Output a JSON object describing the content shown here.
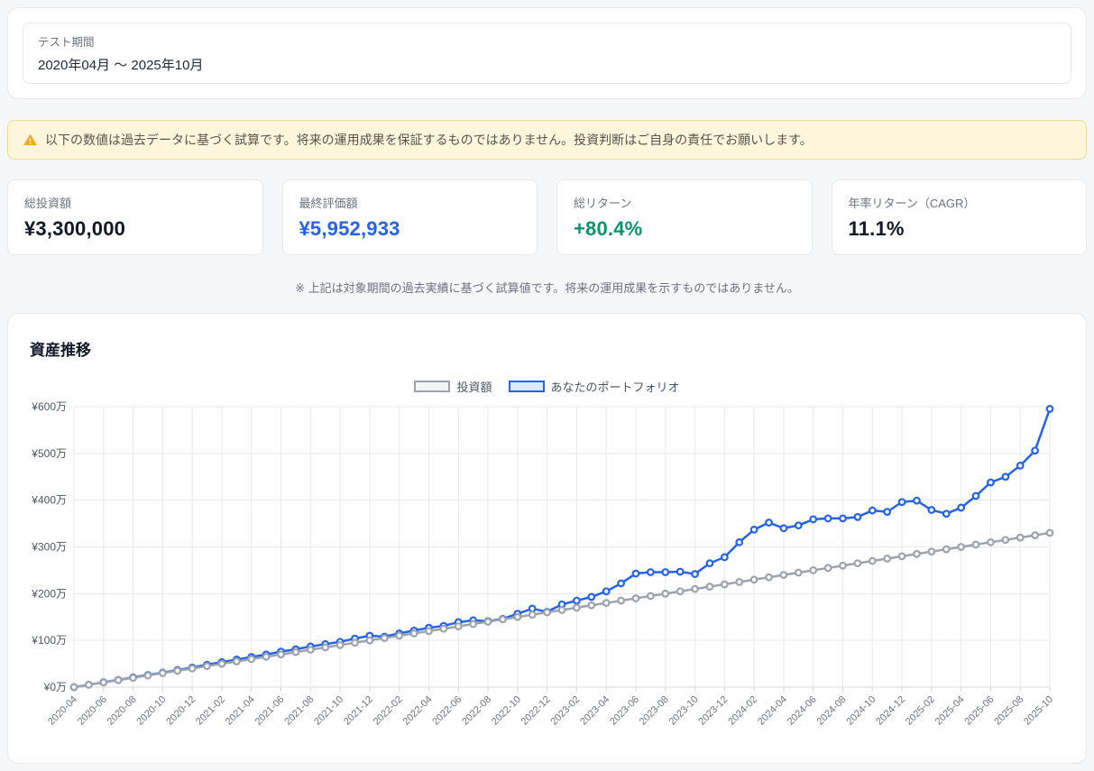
{
  "period": {
    "label": "テスト期間",
    "value": "2020年04月 〜 2025年10月"
  },
  "warning": {
    "text": "以下の数値は過去データに基づく試算です。将来の運用成果を保証するものではありません。投資判断はご自身の責任でお願いします。",
    "icon_color": "#f5a623"
  },
  "stats": [
    {
      "label": "総投資額",
      "value": "¥3,300,000",
      "color": "#111827"
    },
    {
      "label": "最終評価額",
      "value": "¥5,952,933",
      "color": "#2563eb"
    },
    {
      "label": "総リターン",
      "value": "+80.4%",
      "color": "#059669"
    },
    {
      "label": "年率リターン（CAGR）",
      "value": "11.1%",
      "color": "#111827"
    }
  ],
  "footnote": "※ 上記は対象期間の過去実績に基づく試算値です。将来の運用成果を示すものではありません。",
  "chart": {
    "title": "資産推移"
  },
  "chart_data": {
    "type": "line",
    "title": "資産推移",
    "unit": "万円 (10,000 JPY)",
    "y_prefix": "¥",
    "y_suffix": "万",
    "y_ticks": [
      0,
      100,
      200,
      300,
      400,
      500,
      600
    ],
    "ylim": [
      0,
      600
    ],
    "x_tick_every": 2,
    "grid": true,
    "legend_position": "top",
    "x": [
      "2020-04",
      "2020-05",
      "2020-06",
      "2020-07",
      "2020-08",
      "2020-09",
      "2020-10",
      "2020-11",
      "2020-12",
      "2021-01",
      "2021-02",
      "2021-03",
      "2021-04",
      "2021-05",
      "2021-06",
      "2021-07",
      "2021-08",
      "2021-09",
      "2021-10",
      "2021-11",
      "2021-12",
      "2022-01",
      "2022-02",
      "2022-03",
      "2022-04",
      "2022-05",
      "2022-06",
      "2022-07",
      "2022-08",
      "2022-09",
      "2022-10",
      "2022-11",
      "2022-12",
      "2023-01",
      "2023-02",
      "2023-03",
      "2023-04",
      "2023-05",
      "2023-06",
      "2023-07",
      "2023-08",
      "2023-09",
      "2023-10",
      "2023-11",
      "2023-12",
      "2024-01",
      "2024-02",
      "2024-03",
      "2024-04",
      "2024-05",
      "2024-06",
      "2024-07",
      "2024-08",
      "2024-09",
      "2024-10",
      "2024-11",
      "2024-12",
      "2025-01",
      "2025-02",
      "2025-03",
      "2025-04",
      "2025-05",
      "2025-06",
      "2025-07",
      "2025-08",
      "2025-09",
      "2025-10"
    ],
    "series": [
      {
        "name": "投資額",
        "color": "#9ca3af",
        "fill_color": "#f3f4f6",
        "values": [
          0,
          5,
          10,
          15,
          20,
          25,
          30,
          35,
          40,
          45,
          50,
          55,
          60,
          65,
          70,
          75,
          80,
          85,
          90,
          95,
          100,
          105,
          110,
          115,
          120,
          125,
          130,
          135,
          140,
          145,
          150,
          155,
          160,
          165,
          170,
          175,
          180,
          185,
          190,
          195,
          200,
          205,
          210,
          215,
          220,
          225,
          230,
          235,
          240,
          245,
          250,
          255,
          260,
          265,
          270,
          275,
          280,
          285,
          290,
          295,
          300,
          305,
          310,
          315,
          320,
          325,
          330
        ]
      },
      {
        "name": "あなたのポートフォリオ",
        "color": "#2563eb",
        "fill_color": "#dbeafe",
        "values": [
          0,
          5,
          10.5,
          15.5,
          21,
          26,
          31,
          36.5,
          42,
          48,
          53.5,
          59,
          64.5,
          70,
          76,
          81,
          87,
          92,
          97,
          104,
          110,
          108,
          115,
          121,
          127,
          131,
          139,
          143,
          141,
          146,
          157,
          168,
          161,
          177,
          185,
          193,
          205,
          222,
          243,
          246,
          246,
          247,
          242,
          265,
          278,
          310,
          337,
          352,
          340,
          346,
          359,
          361,
          361,
          364,
          378,
          375,
          396,
          399,
          379,
          371,
          384,
          409,
          438,
          450,
          474,
          506,
          595.3
        ]
      }
    ]
  }
}
